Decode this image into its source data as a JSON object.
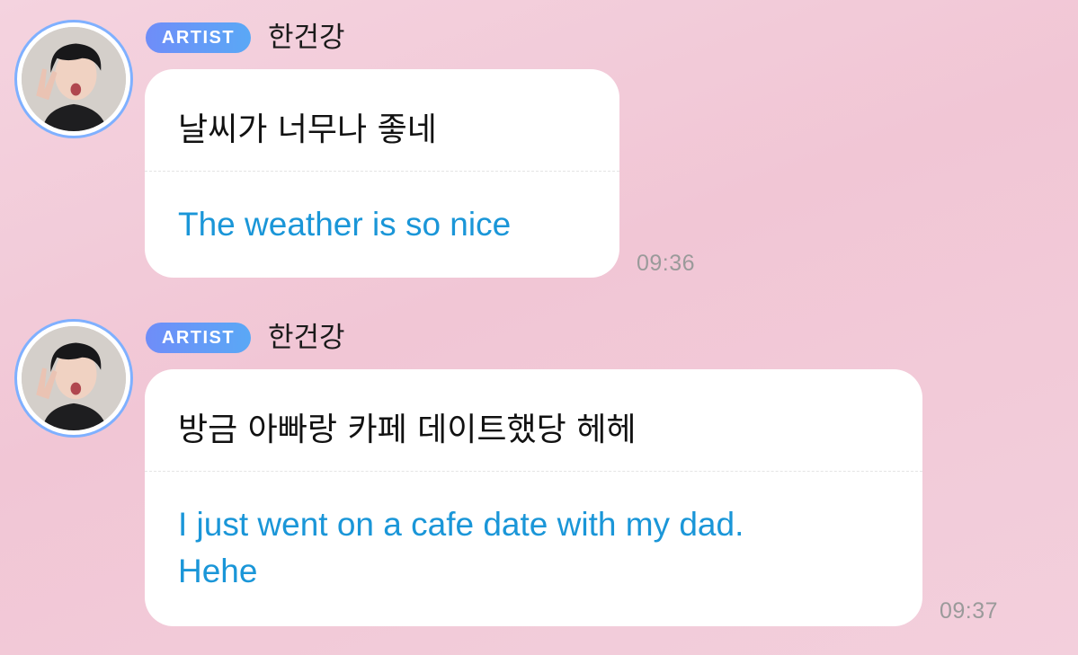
{
  "messages": [
    {
      "badge": "ARTIST",
      "sender": "한건강",
      "original": "날씨가 너무나 좋네",
      "translation": "The weather is so nice",
      "time": "09:36",
      "avatar": "artist-avatar-photo"
    },
    {
      "badge": "ARTIST",
      "sender": "한건강",
      "original": "방금 아빠랑 카페 데이트했당 헤헤",
      "translation": "I just went on a cafe date with my dad.\nHehe",
      "time": "09:37",
      "avatar": "artist-avatar-photo"
    }
  ],
  "colors": {
    "badge_gradient_start": "#6f8df8",
    "badge_gradient_end": "#5aa8f6",
    "translation_text": "#1a96d8",
    "avatar_ring": "#7fb0ff",
    "background": "#f3cfdc"
  }
}
